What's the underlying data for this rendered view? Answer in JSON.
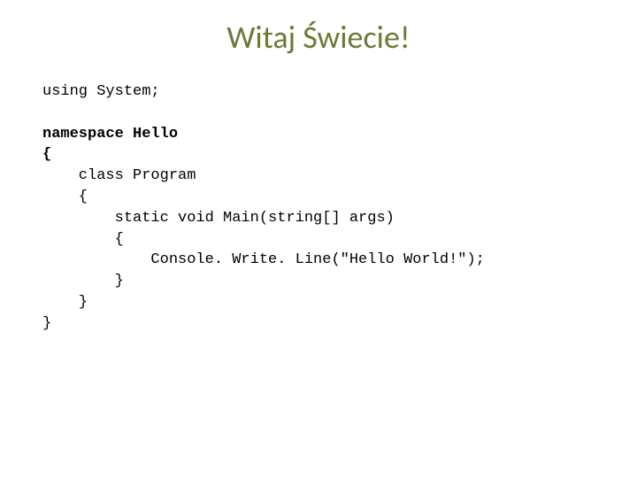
{
  "title": "Witaj Świecie!",
  "code": {
    "l1": "using System;",
    "blank1": "",
    "l2": "namespace Hello",
    "l3": "{",
    "l4": "    class Program",
    "l5": "    {",
    "l6": "        static void Main(string[] args)",
    "l7": "        {",
    "l8": "            Console. Write. Line(\"Hello World!\");",
    "l9": "        }",
    "l10": "    }",
    "l11": "}"
  }
}
